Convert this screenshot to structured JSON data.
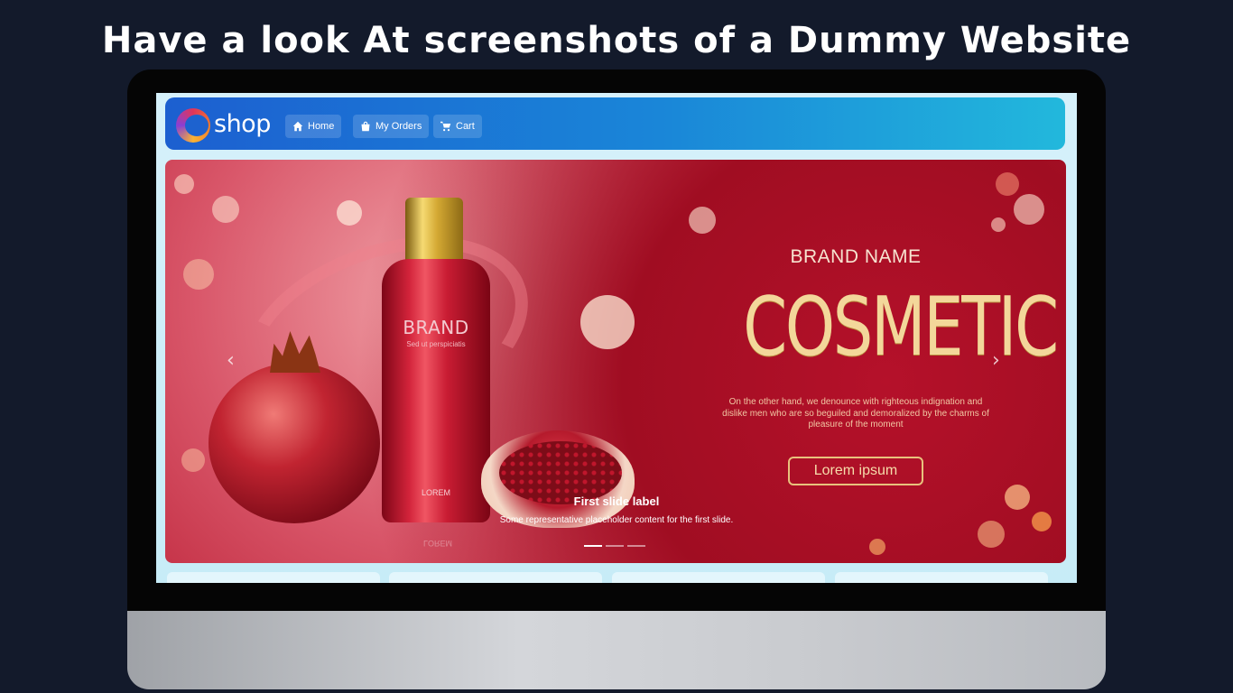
{
  "headline": "Have a look At screenshots of a Dummy Website",
  "navbar": {
    "logo_text": "shop",
    "items": [
      {
        "label": "Home",
        "icon": "home-icon"
      },
      {
        "label": "My Orders",
        "icon": "shopping-bag-icon"
      },
      {
        "label": "Cart",
        "icon": "cart-icon"
      }
    ]
  },
  "hero": {
    "bottle_brand": "BRAND",
    "bottle_subtext": "Sed ut perspiciatis",
    "bottle_lorem": "LOREM",
    "brand_name": "BRAND NAME",
    "cosmetic": "COSMETIC",
    "description": "On the other hand, we denounce with righteous indignation and dislike men who are so beguiled and demoralized by the charms of pleasure of the moment",
    "cta_label": "Lorem ipsum",
    "caption_title": "First slide label",
    "caption_text": "Some representative placeholder content for the first slide.",
    "prev_icon": "chevron-left-icon",
    "next_icon": "chevron-right-icon",
    "active_slide": 1,
    "slide_count": 3
  },
  "colors": {
    "page_background": "#131a2b",
    "navbar_start": "#1c5fd0",
    "navbar_end": "#22b8dc",
    "hero_red": "#a50f25",
    "gold": "#f3d79a"
  }
}
